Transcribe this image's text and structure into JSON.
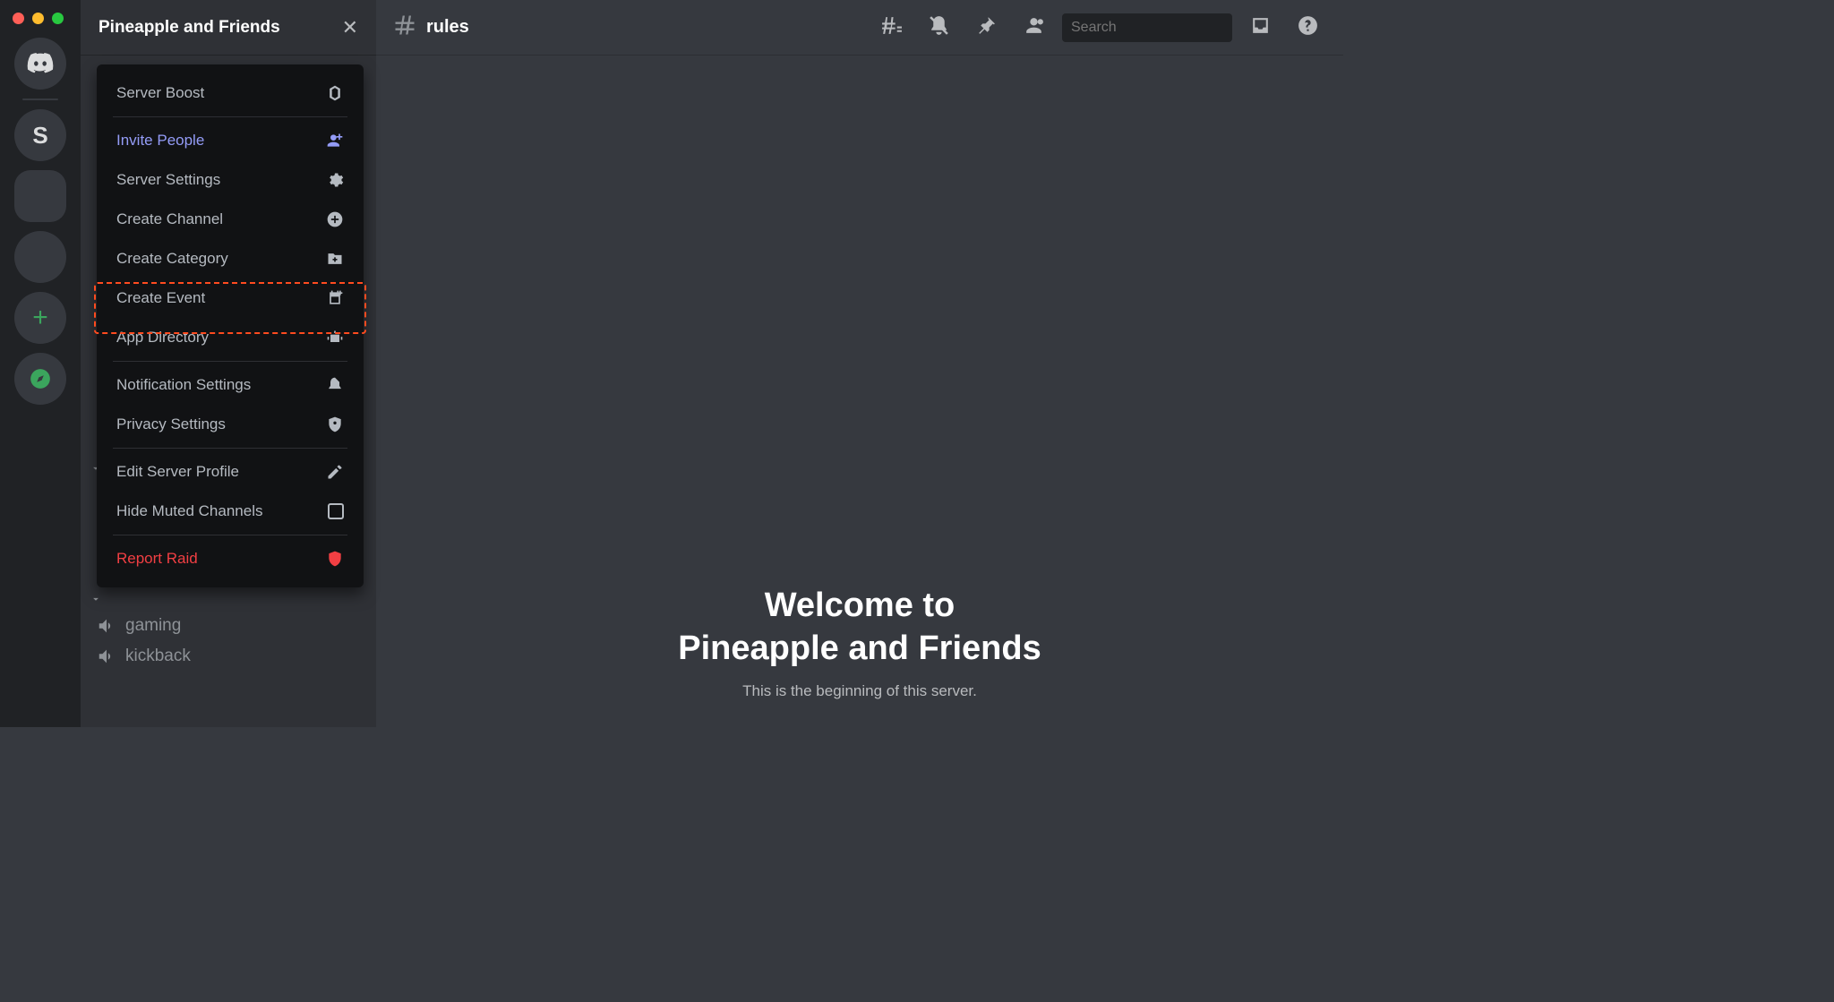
{
  "server": {
    "name": "Pineapple and Friends"
  },
  "channel": {
    "name": "rules"
  },
  "search": {
    "placeholder": "Search"
  },
  "rail": {
    "letter": "S"
  },
  "menu": {
    "boost": "Server Boost",
    "invite": "Invite People",
    "settings": "Server Settings",
    "create_channel": "Create Channel",
    "create_category": "Create Category",
    "create_event": "Create Event",
    "app_directory": "App Directory",
    "notif": "Notification Settings",
    "privacy": "Privacy Settings",
    "edit_profile": "Edit Server Profile",
    "hide_muted": "Hide Muted Channels",
    "report": "Report Raid"
  },
  "channels": {
    "gaming": "gaming",
    "kickback": "kickback"
  },
  "welcome": {
    "line1": "Welcome to",
    "line2": "Pineapple and Friends",
    "sub": "This is the beginning of this server."
  }
}
